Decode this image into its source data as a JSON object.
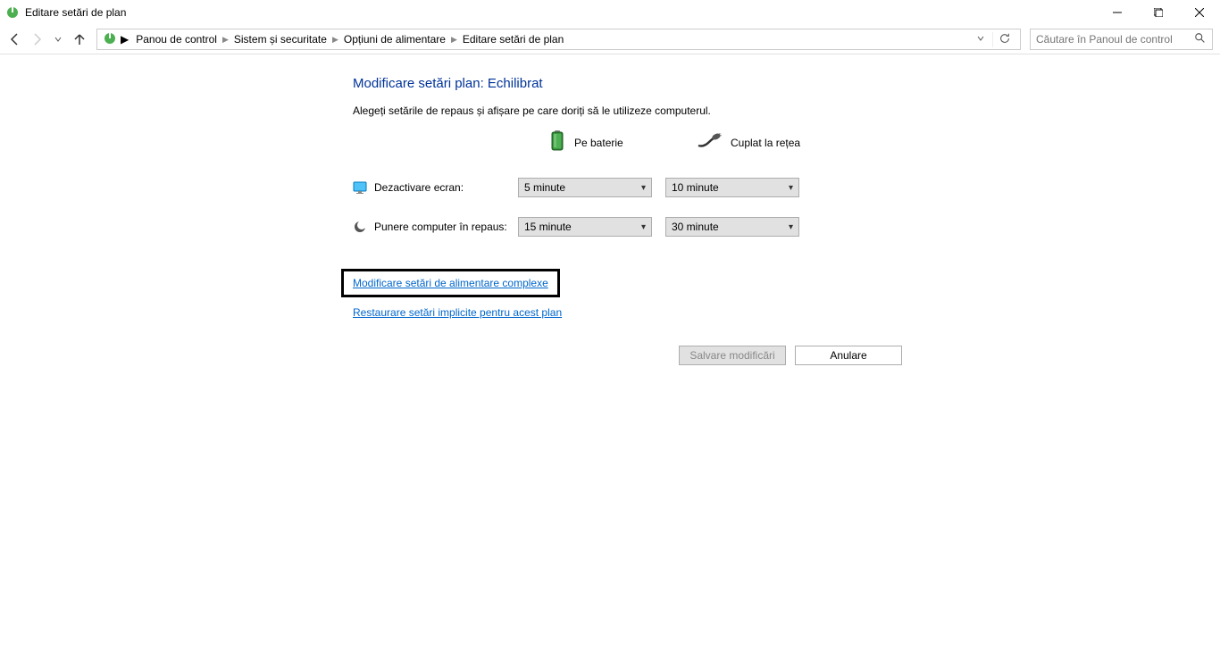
{
  "window": {
    "title": "Editare setări de plan"
  },
  "breadcrumbs": {
    "items": [
      "Panou de control",
      "Sistem și securitate",
      "Opțiuni de alimentare",
      "Editare setări de plan"
    ]
  },
  "search": {
    "placeholder": "Căutare în Panoul de control"
  },
  "page": {
    "heading": "Modificare setări plan: Echilibrat",
    "subtitle": "Alegeți setările de repaus și afișare pe care doriți să le utilizeze computerul.",
    "battery_col": "Pe baterie",
    "plugged_col": "Cuplat la rețea",
    "display_off": {
      "label": "Dezactivare ecran:",
      "battery": "5 minute",
      "plugged": "10 minute"
    },
    "sleep": {
      "label": "Punere computer în repaus:",
      "battery": "15 minute",
      "plugged": "30 minute"
    },
    "advanced_link": "Modificare setări de alimentare complexe",
    "restore_link": "Restaurare setări implicite pentru acest plan",
    "save_button": "Salvare modificări",
    "cancel_button": "Anulare"
  }
}
